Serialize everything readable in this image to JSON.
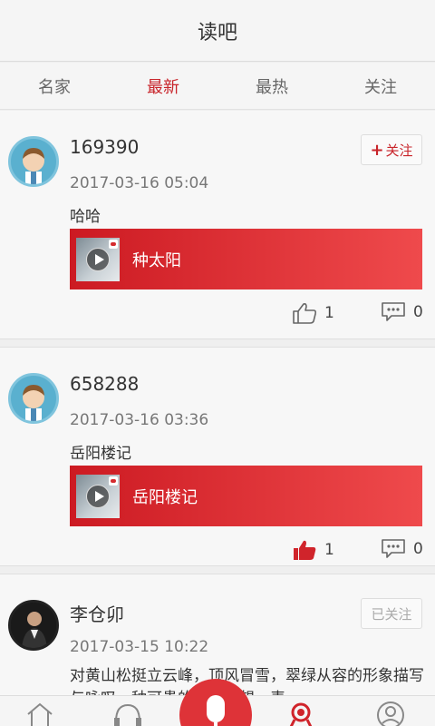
{
  "header": {
    "title": "读吧"
  },
  "tabs": [
    {
      "label": "名家"
    },
    {
      "label": "最新"
    },
    {
      "label": "最热"
    },
    {
      "label": "关注"
    }
  ],
  "posts": [
    {
      "user": "169390",
      "follow_label": "关注",
      "date": "2017-03-16  05:04",
      "text": "哈哈",
      "track": "种太阳",
      "likes": "1",
      "comments": "0",
      "liked": false
    },
    {
      "user": "658288",
      "date": "2017-03-16  03:36",
      "text": "岳阳楼记",
      "track": "岳阳楼记",
      "likes": "1",
      "comments": "0",
      "liked": true
    },
    {
      "user": "李仓卯",
      "follow_label": "已关注",
      "date": "2017-03-15  10:22",
      "text": "对黄山松挺立云峰，顶风冒雪，翠绿从容的形象描写与咏叹，种可贵的人文思想，表"
    }
  ],
  "colors": {
    "accent": "#c8242a",
    "track_start": "#cc1a22",
    "track_end": "#ef4a4c"
  },
  "icons": {
    "nav": [
      "home-icon",
      "headphones-icon",
      "mic-icon",
      "medal-icon",
      "profile-icon"
    ]
  }
}
